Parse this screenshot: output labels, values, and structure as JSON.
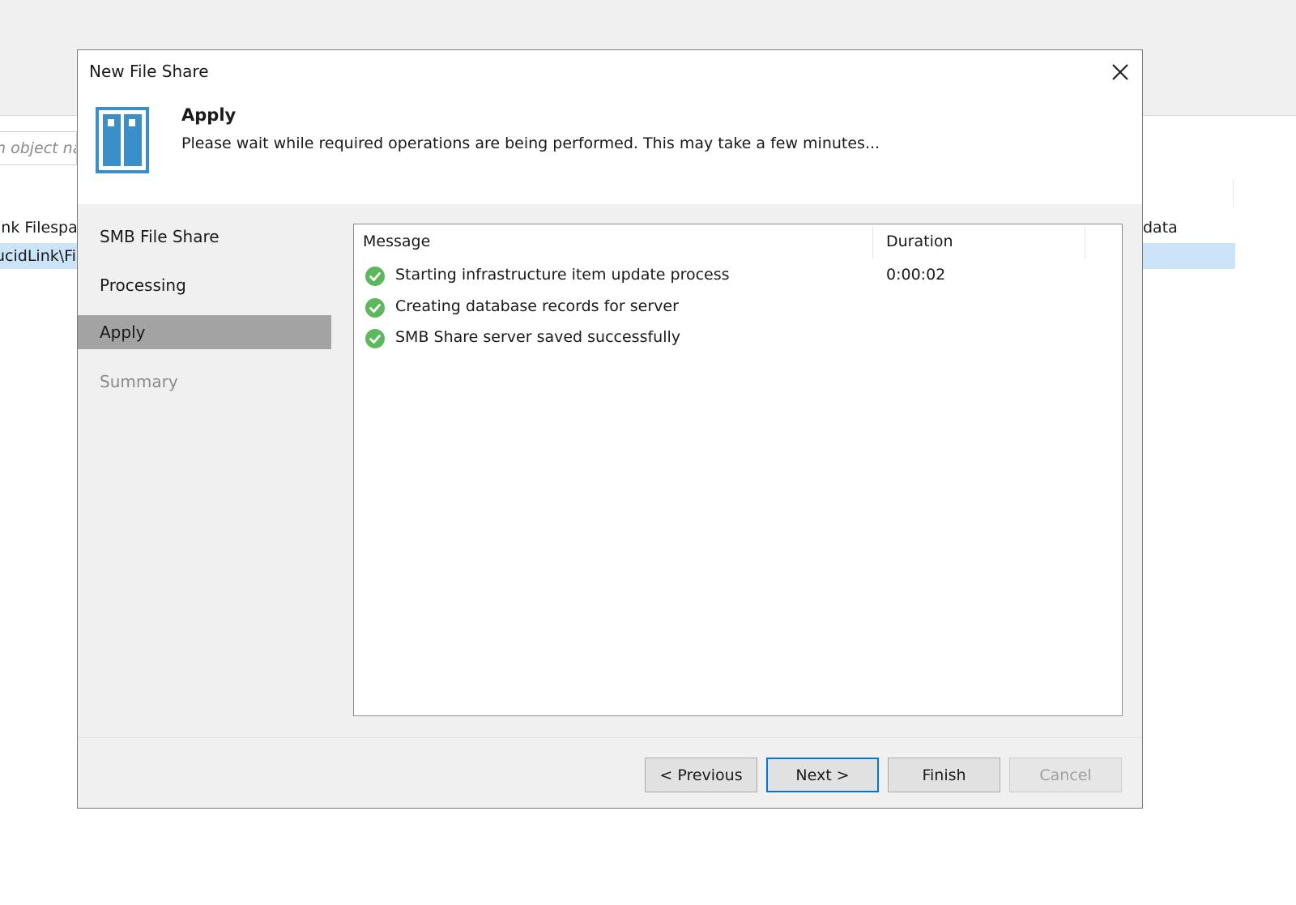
{
  "background_app": {
    "search_placeholder": "n object na",
    "list_item_1": "ink Filespa",
    "list_item_2": "ucidLink\\Fi",
    "right_column_header": "data"
  },
  "dialog": {
    "title": "New File Share",
    "close_icon": "close-icon",
    "header_icon": "file-share-icon",
    "header": {
      "heading": "Apply",
      "description": "Please wait while required operations are being performed. This may take a few minutes..."
    },
    "steps": [
      {
        "label": "SMB File Share",
        "state": "normal"
      },
      {
        "label": "Processing",
        "state": "normal"
      },
      {
        "label": "Apply",
        "state": "active"
      },
      {
        "label": "Summary",
        "state": "disabled"
      }
    ],
    "log": {
      "columns": {
        "message": "Message",
        "duration": "Duration"
      },
      "rows": [
        {
          "status_icon": "check-circle-icon",
          "message": "Starting infrastructure item update process",
          "duration": "0:00:02"
        },
        {
          "status_icon": "check-circle-icon",
          "message": "Creating database records for server",
          "duration": ""
        },
        {
          "status_icon": "check-circle-icon",
          "message": "SMB Share server saved successfully",
          "duration": ""
        }
      ]
    },
    "buttons": {
      "previous": "< Previous",
      "next": "Next >",
      "finish": "Finish",
      "cancel": "Cancel"
    }
  },
  "colors": {
    "accent": "#0078d7",
    "success": "#5cb85c",
    "icon_blue": "#3a8fc9",
    "selection": "#cce4f7",
    "active_step": "#a3a3a3"
  }
}
